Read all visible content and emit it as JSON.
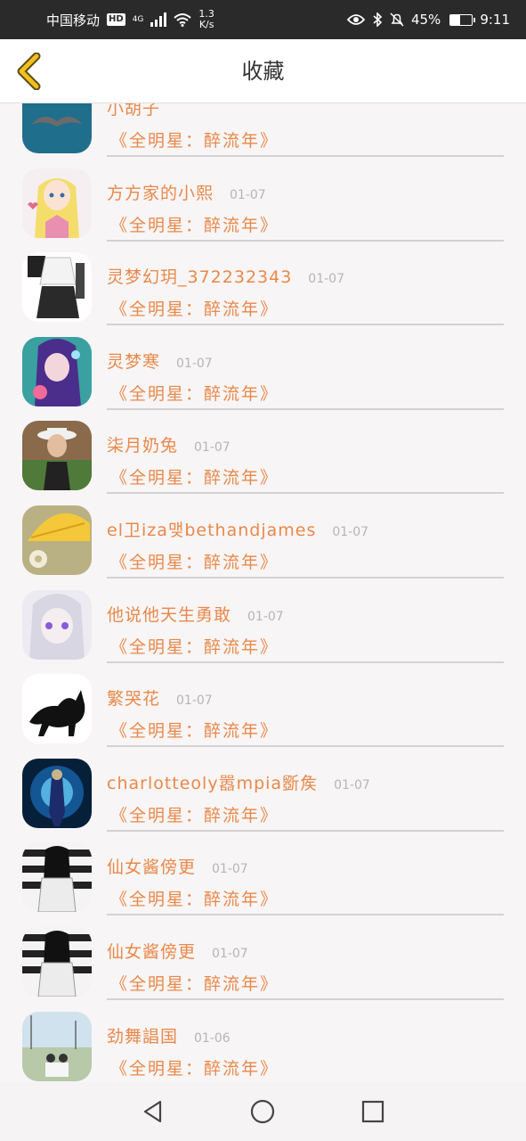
{
  "status_bar": {
    "carrier": "中国移动",
    "hd": "HD",
    "network": "4G",
    "speed_value": "1.3",
    "speed_unit": "K/s",
    "battery": "45%",
    "battery_level": 0.45,
    "time": "9:11"
  },
  "header": {
    "title": "收藏"
  },
  "items": [
    {
      "username": "小胡子",
      "date": "",
      "title": "《全明星：醉流年》",
      "avatar": "mustache"
    },
    {
      "username": "方方家的小熙",
      "date": "01-07",
      "title": "《全明星：醉流年》",
      "avatar": "anime-blonde"
    },
    {
      "username": "灵梦幻玥_372232343",
      "date": "01-07",
      "title": "《全明星：醉流年》",
      "avatar": "outfit"
    },
    {
      "username": "灵梦寒",
      "date": "01-07",
      "title": "《全明星：醉流年》",
      "avatar": "anime-purple"
    },
    {
      "username": "柒月奶兔",
      "date": "01-07",
      "title": "《全明星：醉流年》",
      "avatar": "girl-hat"
    },
    {
      "username": "el卫iza맺bethandjames",
      "date": "01-07",
      "title": "《全明星：醉流年》",
      "avatar": "yellow-flower"
    },
    {
      "username": "他说他天生勇敢",
      "date": "01-07",
      "title": "《全明星：醉流年》",
      "avatar": "anime-white"
    },
    {
      "username": "繁哭花",
      "date": "01-07",
      "title": "《全明星：醉流年》",
      "avatar": "black-cat"
    },
    {
      "username": "charlotteoly嚣mpia斵矦",
      "date": "01-07",
      "title": "《全明星：醉流年》",
      "avatar": "blue-warrior"
    },
    {
      "username": "仙女酱傍更",
      "date": "01-07",
      "title": "《全明星：醉流年》",
      "avatar": "girl-stripes"
    },
    {
      "username": "仙女酱傍更",
      "date": "01-07",
      "title": "《全明星：醉流年》",
      "avatar": "girl-stripes"
    },
    {
      "username": "劲舞誯国",
      "date": "01-06",
      "title": "《全明星：醉流年》",
      "avatar": "couple-field"
    }
  ],
  "colors": {
    "accent": "#e8894a",
    "back_arrow": "#f0c020",
    "background": "#f8f5f6"
  },
  "icons": {
    "back": "chevron-left-icon",
    "nav_back": "triangle-back-icon",
    "nav_home": "circle-home-icon",
    "nav_recents": "square-recents-icon"
  }
}
